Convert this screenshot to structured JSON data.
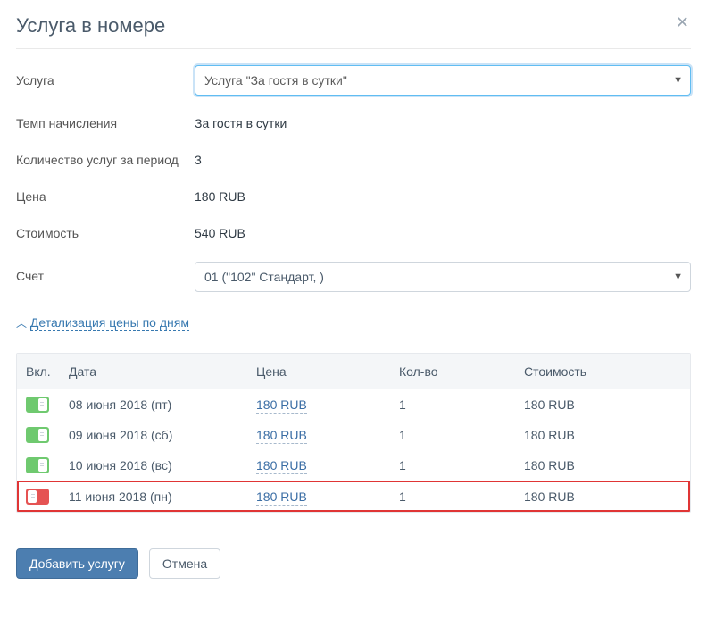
{
  "modal": {
    "title": "Услуга в номере"
  },
  "form": {
    "labels": {
      "service": "Услуга",
      "rate_type": "Темп начисления",
      "qty_period": "Количество услуг за период",
      "price": "Цена",
      "cost": "Стоимость",
      "account": "Счет"
    },
    "service_select": "Услуга \"За гостя в сутки\"",
    "rate_type_value": "За гостя в сутки",
    "qty_period_value": "3",
    "price_value": "180 RUB",
    "cost_value": "540 RUB",
    "account_select": "01 (\"102\" Стандарт,               )"
  },
  "detail": {
    "toggle_label": "Детализация цены по дням",
    "columns": {
      "enabled": "Вкл.",
      "date": "Дата",
      "price": "Цена",
      "qty": "Кол-во",
      "cost": "Стоимость"
    },
    "rows": [
      {
        "enabled": true,
        "date": "08 июня 2018 (пт)",
        "price": "180 RUB",
        "qty": "1",
        "cost": "180 RUB",
        "highlight": false
      },
      {
        "enabled": true,
        "date": "09 июня 2018 (сб)",
        "price": "180 RUB",
        "qty": "1",
        "cost": "180 RUB",
        "highlight": false
      },
      {
        "enabled": true,
        "date": "10 июня 2018 (вс)",
        "price": "180 RUB",
        "qty": "1",
        "cost": "180 RUB",
        "highlight": false
      },
      {
        "enabled": false,
        "date": "11 июня 2018 (пн)",
        "price": "180 RUB",
        "qty": "1",
        "cost": "180 RUB",
        "highlight": true
      }
    ]
  },
  "toolbar": {
    "submit": "Добавить услугу",
    "cancel": "Отмена"
  }
}
